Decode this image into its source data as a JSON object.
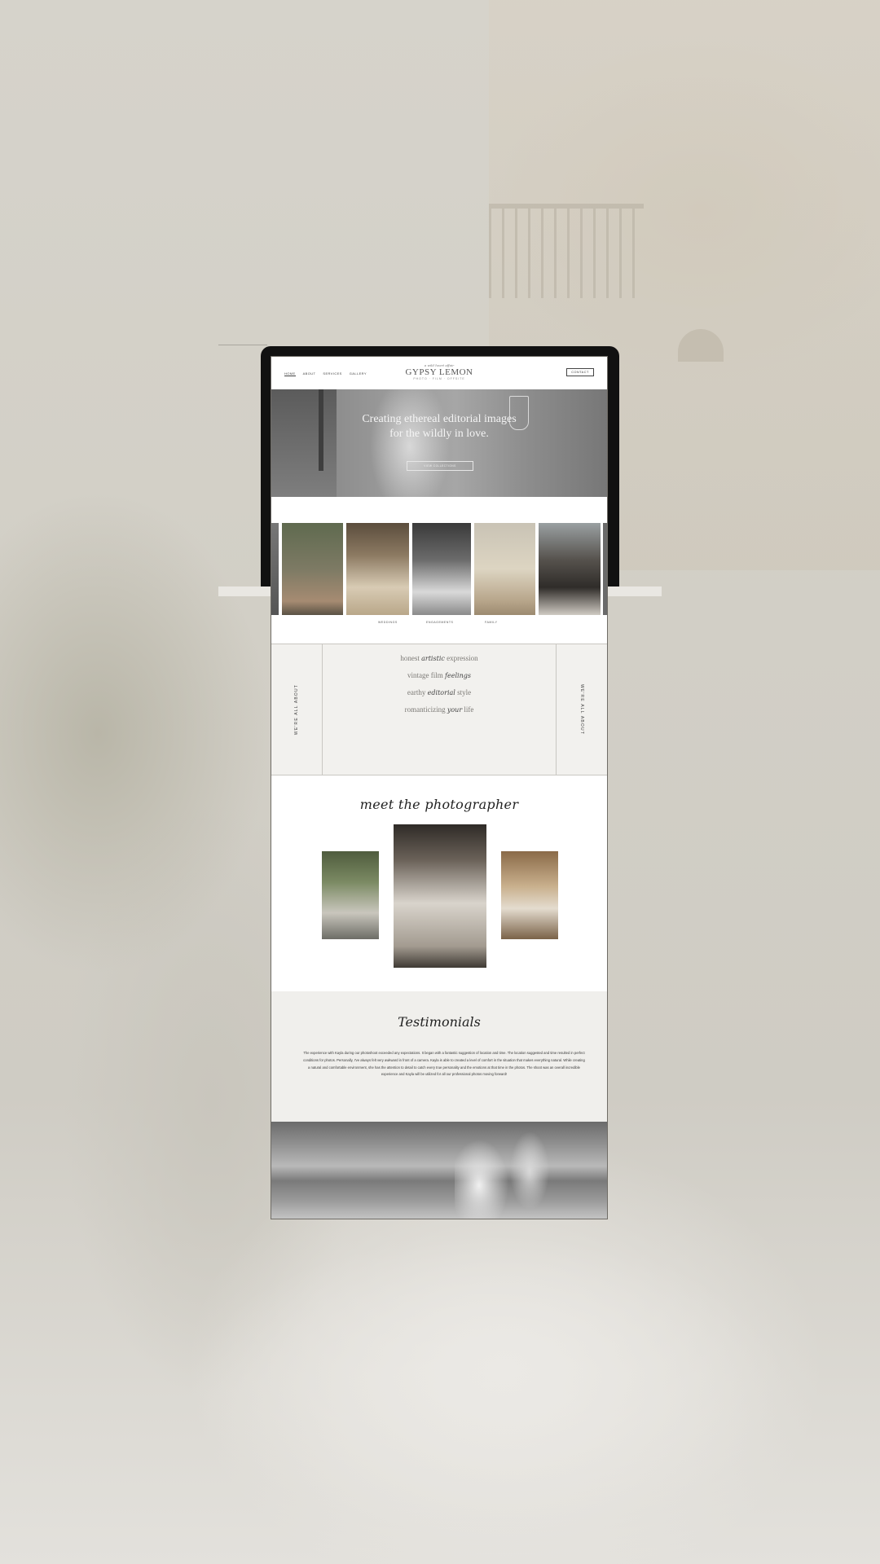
{
  "site": {
    "nav": [
      "Home",
      "About",
      "Services",
      "Gallery"
    ],
    "logo": {
      "script": "a wild heart affair",
      "name": "GYPSY LEMON",
      "sub": "PHOTO · FILM · OFFSITE"
    },
    "contact_label": "CONTACT"
  },
  "hero": {
    "title_line1": "Creating ethereal editorial images",
    "title_line2": "for the wildly in love.",
    "copy": "",
    "button_label": "VIEW COLLECTIONS"
  },
  "gallery": {
    "labels": [
      "WEDDINGS",
      "ENGAGEMENTS",
      "FAMILY"
    ]
  },
  "about": {
    "side_label": "WE'RE ALL ABOUT",
    "items": [
      {
        "pre": "honest",
        "script": "artistic",
        "post": "expression",
        "sub": ""
      },
      {
        "pre": "vintage film",
        "script": "feelings",
        "post": "",
        "sub": ""
      },
      {
        "pre": "earthy",
        "script": "editorial",
        "post": "style",
        "sub": ""
      },
      {
        "pre": "romanticizing",
        "script": "your",
        "post": "life",
        "sub": ""
      }
    ]
  },
  "meet": {
    "title": "meet the photographer"
  },
  "testimonials": {
    "title": "Testimonials",
    "body": "The experience with Kayla during our photoshoot exceeded any expectations. It began with a fantastic suggestion of location and time. The location suggested and time resulted in perfect conditions for photos. Personally, I've always felt very awkward in front of a camera. Kayla is able to created a level of comfort in the situation that makes everything natural. While creating a natural and comfortable environment, she has the attention to detail to catch every true personality and the emotions at that time in the photos. The shoot was an overall incredible experience and Kayla will be utilized for all our professional photos moving forward!"
  }
}
